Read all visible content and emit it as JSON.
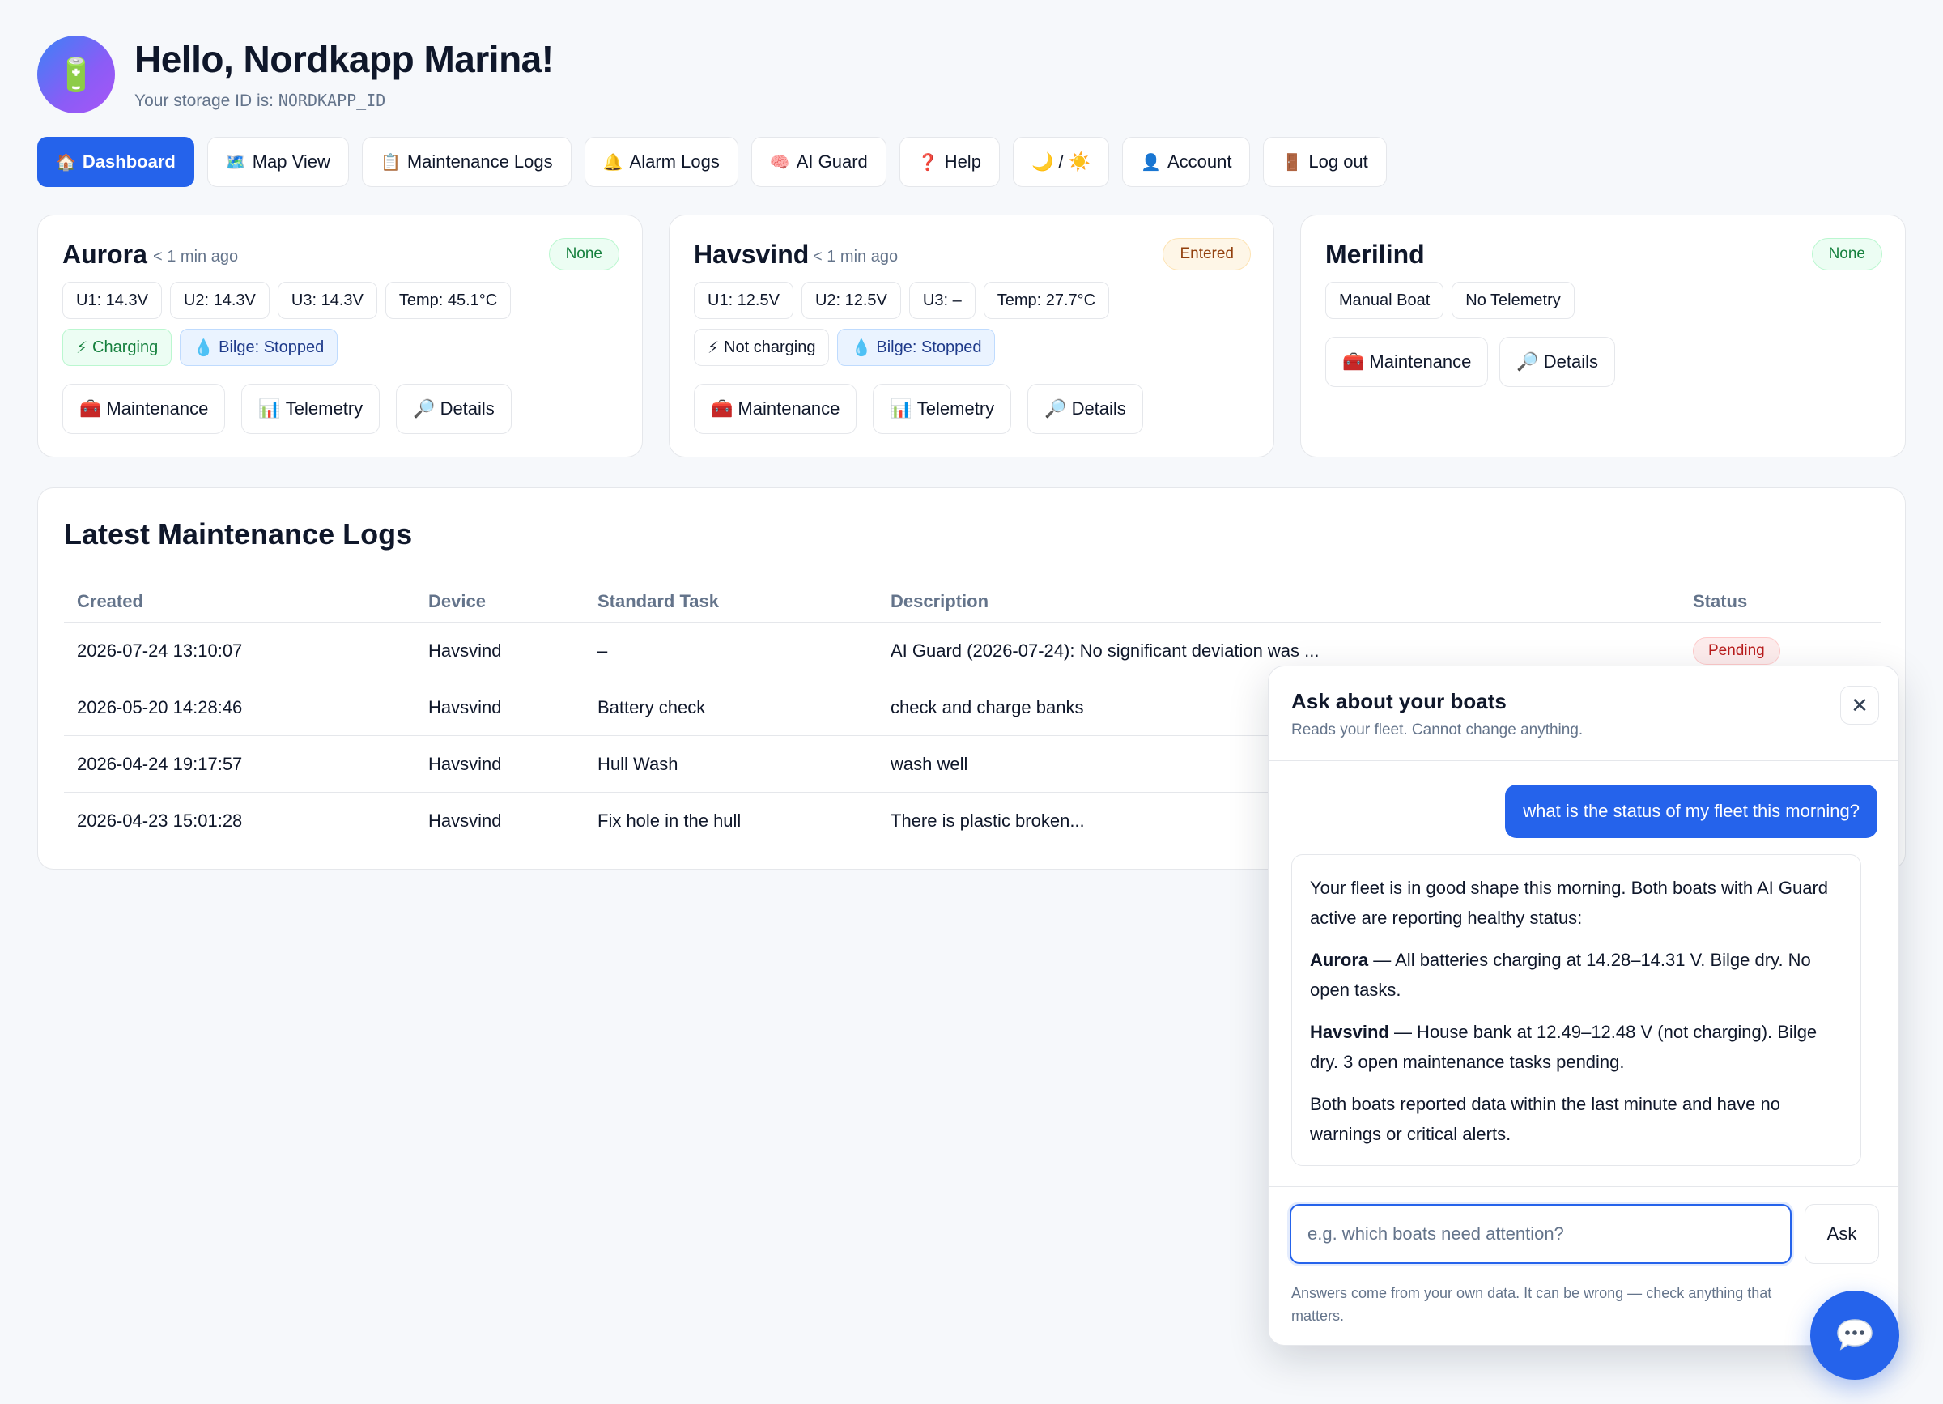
{
  "header": {
    "avatar_icon": "🔋",
    "title": "Hello, Nordkapp Marina!",
    "storage_prefix": "Your storage ID is: ",
    "storage_id": "NORDKAPP_ID"
  },
  "nav": [
    {
      "icon": "🏠",
      "label": "Dashboard"
    },
    {
      "icon": "🗺️",
      "label": "Map View"
    },
    {
      "icon": "📋",
      "label": "Maintenance Logs"
    },
    {
      "icon": "🔔",
      "label": "Alarm Logs"
    },
    {
      "icon": "🧠",
      "label": "AI Guard"
    },
    {
      "icon": "❓",
      "label": "Help"
    },
    {
      "icon": "🌙 / ☀️",
      "label": ""
    },
    {
      "icon": "👤",
      "label": "Account"
    },
    {
      "icon": "🚪",
      "label": "Log out"
    }
  ],
  "boats": {
    "aurora": {
      "name": "Aurora",
      "ago": "< 1 min ago",
      "badge": "None",
      "u1": "U1: 14.3V",
      "u2": "U2: 14.3V",
      "u3": "U3: 14.3V",
      "temp": "Temp: 45.1°C",
      "charge_icon": "⚡",
      "charge": "Charging",
      "bilge_icon": "💧",
      "bilge": "Bilge: Stopped",
      "maint": "Maintenance",
      "telemetry": "Telemetry",
      "details": "Details"
    },
    "havsvind": {
      "name": "Havsvind",
      "ago": "< 1 min ago",
      "badge": "Entered",
      "u1": "U1: 12.5V",
      "u2": "U2: 12.5V",
      "u3": "U3: –",
      "temp": "Temp: 27.7°C",
      "charge_icon": "⚡",
      "charge": "Not charging",
      "bilge_icon": "💧",
      "bilge": "Bilge: Stopped",
      "maint": "Maintenance",
      "telemetry": "Telemetry",
      "details": "Details"
    },
    "merilind": {
      "name": "Merilind",
      "badge": "None",
      "type": "Manual Boat",
      "telemetry_status": "No Telemetry",
      "maint": "Maintenance",
      "details": "Details"
    }
  },
  "icons": {
    "maint": "🧰",
    "telemetry": "📊",
    "details": "🔎",
    "close": "✕",
    "chat": "💬"
  },
  "logs": {
    "title": "Latest Maintenance Logs",
    "headers": {
      "created": "Created",
      "device": "Device",
      "task": "Standard Task",
      "description": "Description",
      "status": "Status"
    },
    "rows": [
      {
        "created": "2026-07-24 13:10:07",
        "device": "Havsvind",
        "task": "–",
        "description": "AI Guard (2026-07-24): No significant deviation was ...",
        "status": "Pending"
      },
      {
        "created": "2026-05-20 14:28:46",
        "device": "Havsvind",
        "task": "Battery check",
        "description": "check and charge banks",
        "status": ""
      },
      {
        "created": "2026-04-24 19:17:57",
        "device": "Havsvind",
        "task": "Hull Wash",
        "description": "wash well",
        "status": ""
      },
      {
        "created": "2026-04-23 15:01:28",
        "device": "Havsvind",
        "task": "Fix hole in the hull",
        "description": "There is plastic broken...",
        "status": ""
      }
    ]
  },
  "chat": {
    "title": "Ask about your boats",
    "subtitle": "Reads your fleet. Cannot change anything.",
    "user_message": "what is the status of my fleet this morning?",
    "bot_intro": "Your fleet is in good shape this morning. Both boats with AI Guard active are reporting healthy status:",
    "bot_aurora_name": "Aurora",
    "bot_aurora_text": " — All batteries charging at 14.28–14.31 V. Bilge dry. No open tasks.",
    "bot_havsvind_name": "Havsvind",
    "bot_havsvind_text": " — House bank at 12.49–12.48 V (not charging). Bilge dry. 3 open maintenance tasks pending.",
    "bot_outro": "Both boats reported data within the last minute and have no warnings or critical alerts.",
    "input_placeholder": "e.g. which boats need attention?",
    "ask_label": "Ask",
    "disclaimer": "Answers come from your own data. It can be wrong — check anything that matters."
  }
}
